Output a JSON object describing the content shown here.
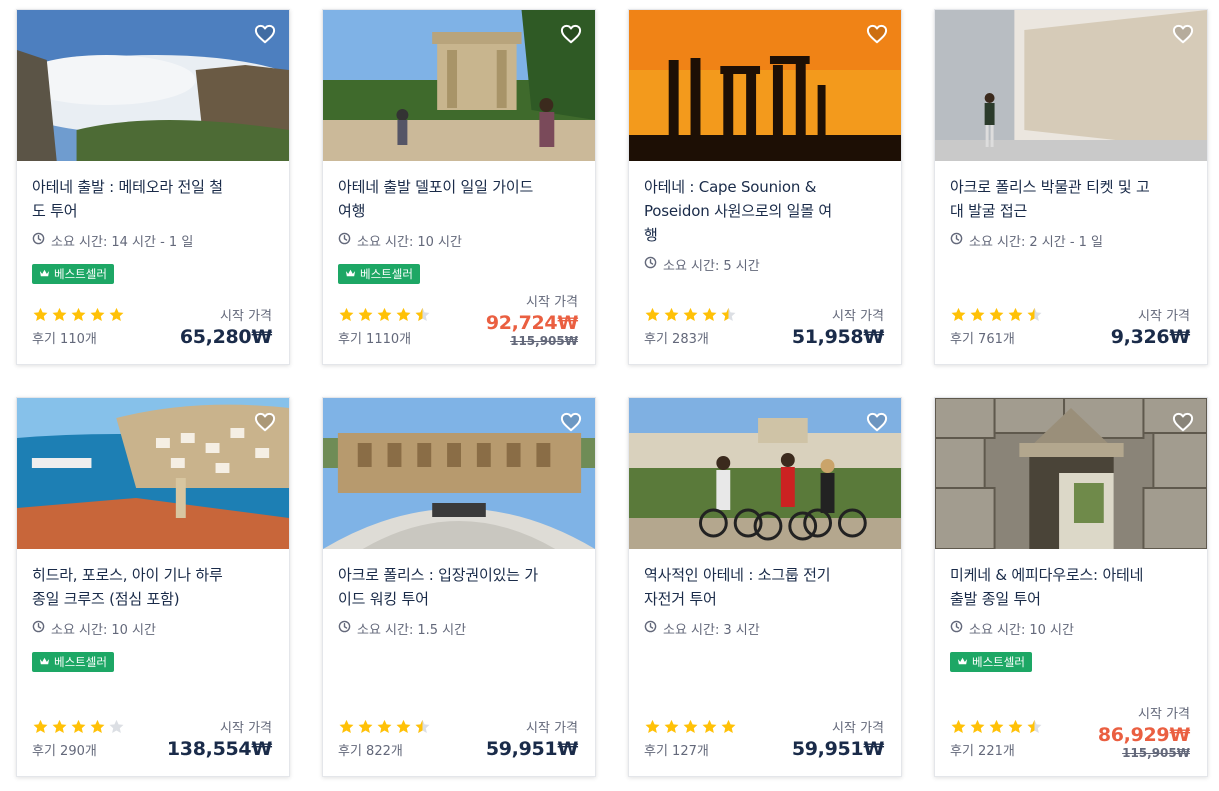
{
  "colors": {
    "badge": "#1da765",
    "star": "#ffc107",
    "sale": "#ea5f41",
    "text": "#1a2b49"
  },
  "cards": [
    {
      "title": "아테네 출발 : 메테오라 전일 철도 투어",
      "duration_label": "소요 시간:",
      "duration": "14 시간 - 1 일",
      "badge": "베스트셀러",
      "rating": 5,
      "reviews": "후기 110개",
      "price_label": "시작 가격",
      "price": "65,280₩",
      "old_price": ""
    },
    {
      "title": "아테네 출발 델포이 일일 가이드 여행",
      "duration_label": "소요 시간:",
      "duration": "10 시간",
      "badge": "베스트셀러",
      "rating": 4.5,
      "reviews": "후기 1110개",
      "price_label": "시작 가격",
      "price": "92,724₩",
      "old_price": "115,905₩"
    },
    {
      "title": "아테네 : Cape Sounion & Poseidon 사원으로의 일몰 여행",
      "duration_label": "소요 시간:",
      "duration": "5 시간",
      "badge": "",
      "rating": 4.5,
      "reviews": "후기 283개",
      "price_label": "시작 가격",
      "price": "51,958₩",
      "old_price": ""
    },
    {
      "title": "아크로 폴리스 박물관 티켓 및 고대 발굴 접근",
      "duration_label": "소요 시간:",
      "duration": "2 시간 - 1 일",
      "badge": "",
      "rating": 4.5,
      "reviews": "후기 761개",
      "price_label": "시작 가격",
      "price": "9,326₩",
      "old_price": ""
    },
    {
      "title": "히드라, 포로스, 아이 기나 하루 종일 크루즈 (점심 포함)",
      "duration_label": "소요 시간:",
      "duration": "10 시간",
      "badge": "베스트셀러",
      "rating": 4,
      "reviews": "후기 290개",
      "price_label": "시작 가격",
      "price": "138,554₩",
      "old_price": ""
    },
    {
      "title": "아크로 폴리스 : 입장권이있는 가이드 워킹 투어",
      "duration_label": "소요 시간:",
      "duration": "1.5 시간",
      "badge": "",
      "rating": 4.5,
      "reviews": "후기 822개",
      "price_label": "시작 가격",
      "price": "59,951₩",
      "old_price": ""
    },
    {
      "title": "역사적인 아테네 : 소그룹 전기 자전거 투어",
      "duration_label": "소요 시간:",
      "duration": "3 시간",
      "badge": "",
      "rating": 5,
      "reviews": "후기 127개",
      "price_label": "시작 가격",
      "price": "59,951₩",
      "old_price": ""
    },
    {
      "title": "미케네 & 에피다우로스: 아테네 출발 종일 투어",
      "duration_label": "소요 시간:",
      "duration": "10 시간",
      "badge": "베스트셀러",
      "rating": 4.5,
      "reviews": "후기 221개",
      "price_label": "시작 가격",
      "price": "86,929₩",
      "old_price": "115,905₩"
    }
  ]
}
